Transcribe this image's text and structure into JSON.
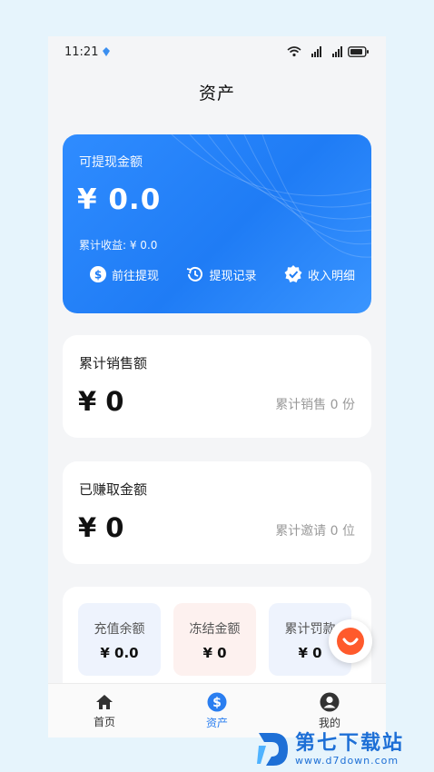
{
  "status_bar": {
    "time": "11:21"
  },
  "page": {
    "title": "资产"
  },
  "balance_card": {
    "label": "可提现金额",
    "amount": "¥ 0.0",
    "earnings": "累计收益: ¥ 0.0",
    "actions": [
      {
        "label": "前往提现",
        "icon": "dollar-circle-icon"
      },
      {
        "label": "提现记录",
        "icon": "history-icon"
      },
      {
        "label": "收入明细",
        "icon": "verified-check-icon"
      }
    ]
  },
  "sales_card": {
    "title": "累计销售额",
    "amount": "¥ 0",
    "side": "累计销售 0 份"
  },
  "earned_card": {
    "title": "已赚取金额",
    "amount": "¥ 0",
    "side": "累计邀请 0 位"
  },
  "mini_cards": [
    {
      "label": "充值余额",
      "value": "¥ 0.0",
      "bg": "#eef3fd"
    },
    {
      "label": "冻结金额",
      "value": "¥ 0",
      "bg": "#fdf1ef"
    },
    {
      "label": "累计罚款",
      "value": "¥ 0",
      "bg": "#eef3fd"
    }
  ],
  "tabbar": {
    "items": [
      {
        "label": "首页",
        "icon": "home-icon"
      },
      {
        "label": "资产",
        "icon": "dollar-circle-icon"
      },
      {
        "label": "我的",
        "icon": "user-icon"
      }
    ],
    "active_color": "#2a7ef0"
  },
  "watermark": {
    "title": "第七下载站",
    "url": "www.d7down.com"
  },
  "colors": {
    "accent": "#2a7ef0",
    "card_blue": "#1f7cf5"
  }
}
